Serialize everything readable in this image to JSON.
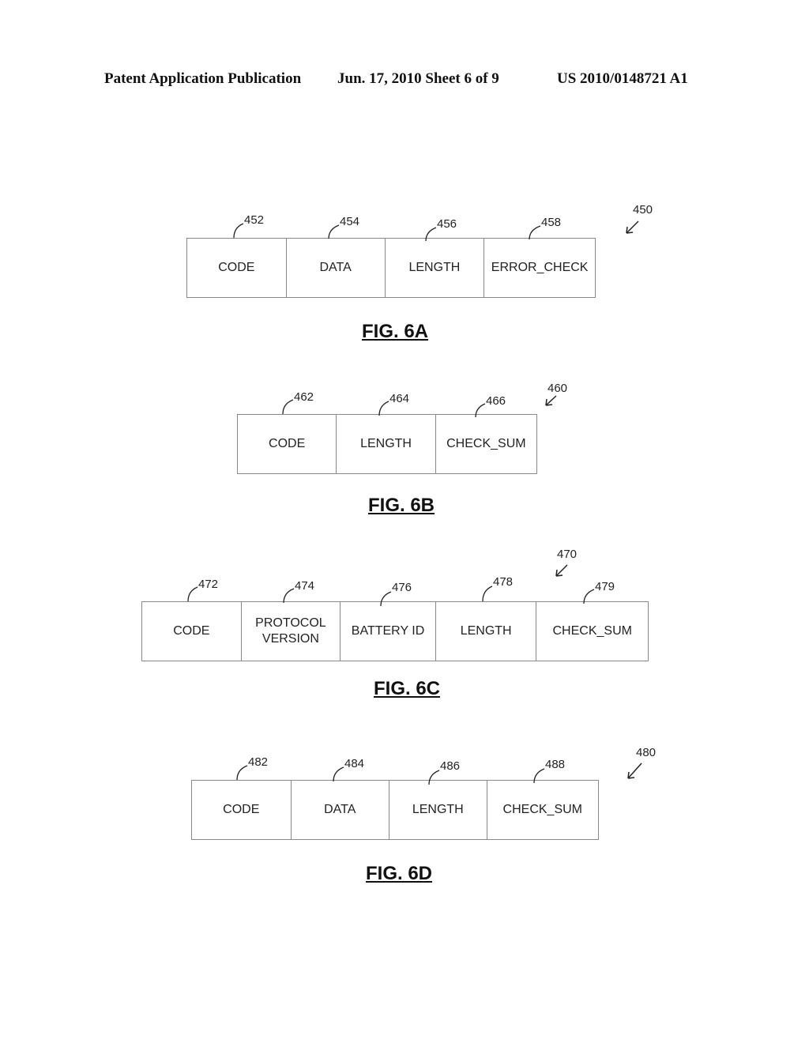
{
  "header": {
    "publication": "Patent Application Publication",
    "date_sheet": "Jun. 17, 2010  Sheet 6 of 9",
    "number": "US 2010/0148721 A1"
  },
  "figures": [
    {
      "id": "6A",
      "caption": "FIG. 6A",
      "ref": "450",
      "fields": [
        {
          "ref": "452",
          "label": "CODE"
        },
        {
          "ref": "454",
          "label": "DATA"
        },
        {
          "ref": "456",
          "label": "LENGTH"
        },
        {
          "ref": "458",
          "label": "ERROR_CHECK"
        }
      ]
    },
    {
      "id": "6B",
      "caption": "FIG. 6B",
      "ref": "460",
      "fields": [
        {
          "ref": "462",
          "label": "CODE"
        },
        {
          "ref": "464",
          "label": "LENGTH"
        },
        {
          "ref": "466",
          "label": "CHECK_SUM"
        }
      ]
    },
    {
      "id": "6C",
      "caption": "FIG. 6C",
      "ref": "470",
      "fields": [
        {
          "ref": "472",
          "label": "CODE"
        },
        {
          "ref": "474",
          "label": "PROTOCOL VERSION",
          "line1": "PROTOCOL",
          "line2": "VERSION"
        },
        {
          "ref": "476",
          "label": "BATTERY ID"
        },
        {
          "ref": "478",
          "label": "LENGTH"
        },
        {
          "ref": "479",
          "label": "CHECK_SUM"
        }
      ]
    },
    {
      "id": "6D",
      "caption": "FIG. 6D",
      "ref": "480",
      "fields": [
        {
          "ref": "482",
          "label": "CODE"
        },
        {
          "ref": "484",
          "label": "DATA"
        },
        {
          "ref": "486",
          "label": "LENGTH"
        },
        {
          "ref": "488",
          "label": "CHECK_SUM"
        }
      ]
    }
  ]
}
